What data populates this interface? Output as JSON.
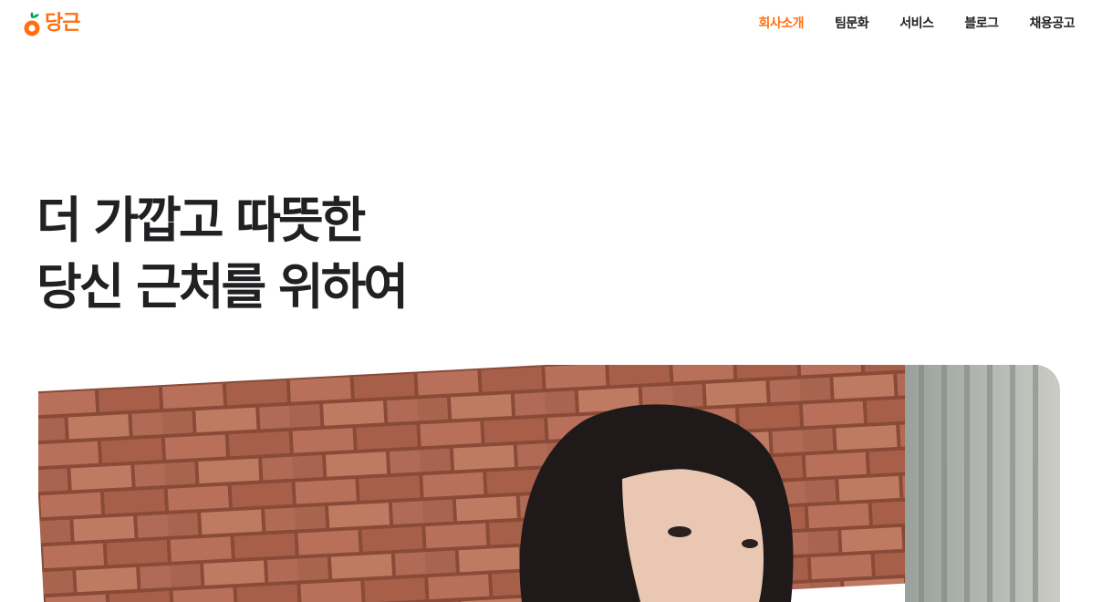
{
  "brand": {
    "name": "당근",
    "accent_color": "#ff6f0f",
    "logo_icon": "carrot-icon"
  },
  "nav": {
    "items": [
      {
        "label": "회사소개",
        "active": true
      },
      {
        "label": "팀문화",
        "active": false
      },
      {
        "label": "서비스",
        "active": false
      },
      {
        "label": "블로그",
        "active": false
      },
      {
        "label": "채용공고",
        "active": false
      }
    ]
  },
  "hero": {
    "line1": "더 가깝고 따뜻한",
    "line2": "당신 근처를 위하여"
  }
}
